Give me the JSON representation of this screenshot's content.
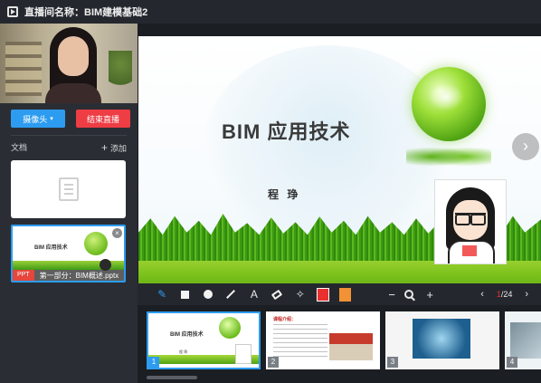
{
  "titlebar": {
    "title": "直播间名称：BIM建模基础2"
  },
  "sidebar": {
    "camera_button": "摄像头",
    "end_button": "结束直播",
    "documents_label": "文档",
    "add_label": "添加",
    "documents": [
      {
        "type": "PPT",
        "name": "第一部分：BIM概述.pptx"
      }
    ]
  },
  "slide": {
    "title": "BIM  应用技术",
    "author": "程 琤"
  },
  "toolbar": {
    "colors": {
      "red": "#ea2f2f",
      "orange": "#f29234"
    },
    "zoom_out": "−",
    "zoom_in": "+",
    "prev": "‹",
    "next": "›",
    "current_page": "1",
    "total_pages": "/24"
  },
  "thumbnails": [
    {
      "num": "1",
      "title": "BIM  应用技术",
      "author": "程 琤"
    },
    {
      "num": "2",
      "header": "课程介绍："
    },
    {
      "num": "3"
    },
    {
      "num": "4"
    }
  ]
}
